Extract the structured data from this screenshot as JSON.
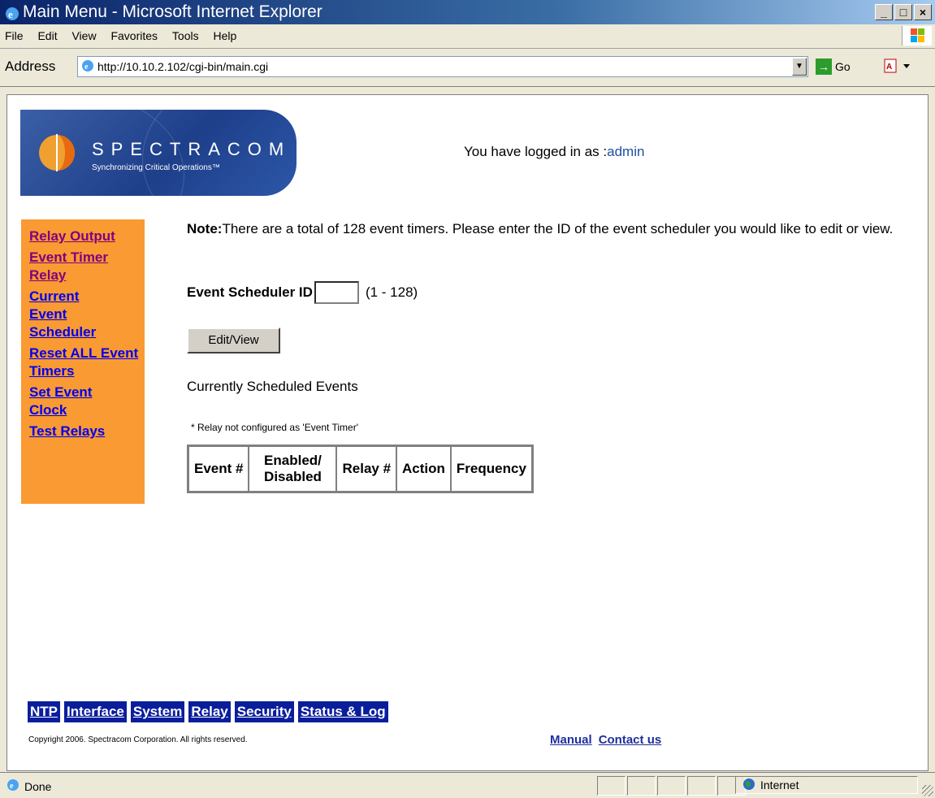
{
  "window": {
    "title": "Main Menu - Microsoft Internet Explorer",
    "buttons": {
      "minimize": "_",
      "maximize": "□",
      "close": "×"
    }
  },
  "menubar": {
    "items": [
      {
        "label": "File"
      },
      {
        "label": "Edit"
      },
      {
        "label": "View"
      },
      {
        "label": "Favorites"
      },
      {
        "label": "Tools"
      },
      {
        "label": "Help"
      }
    ]
  },
  "addressbar": {
    "label": "Address",
    "url": "http://10.10.2.102/cgi-bin/main.cgi",
    "go_label": "Go"
  },
  "page": {
    "logo": {
      "name": "SPECTRACOM",
      "tagline": "Synchronizing Critical Operations™"
    },
    "logged_in": {
      "prefix": "You have logged in as :",
      "user": "admin"
    },
    "sidebar": {
      "items": [
        {
          "label": "Relay Output",
          "visited": true
        },
        {
          "label": "Event Timer Relay",
          "visited": true
        },
        {
          "label": "Current Event Scheduler",
          "visited": false
        },
        {
          "label": "Reset ALL Event Timers",
          "visited": false
        },
        {
          "label": "Set Event Clock",
          "visited": false
        },
        {
          "label": "Test Relays",
          "visited": false
        }
      ]
    },
    "note": {
      "bold": "Note:",
      "text": "There are a total of 128 event timers. Please enter the ID of the event scheduler you would like to edit or view."
    },
    "scheduler": {
      "label": "Event Scheduler ID",
      "value": "",
      "range": "(1 - 128)",
      "button": "Edit/View"
    },
    "currently_scheduled": "Currently Scheduled Events",
    "relay_note": "* Relay not configured as 'Event Timer'",
    "table": {
      "headers": [
        "Event #",
        "Enabled/ Disabled",
        "Relay #",
        "Action",
        "Frequency"
      ]
    },
    "footer_nav": [
      "NTP",
      "Interface",
      "System",
      "Relay",
      "Security",
      "Status & Log"
    ],
    "copyright": "Copyright 2006. Spectracom Corporation. All rights reserved.",
    "footer_links": [
      "Manual",
      "Contact us"
    ]
  },
  "statusbar": {
    "status": "Done",
    "zone": "Internet"
  },
  "colors": {
    "sidebar_bg": "#f99a32",
    "nav_bg": "#0a1e9c",
    "logo_bg": "#1e3f8a",
    "link": "#0000ee",
    "visited_link": "#800080"
  }
}
